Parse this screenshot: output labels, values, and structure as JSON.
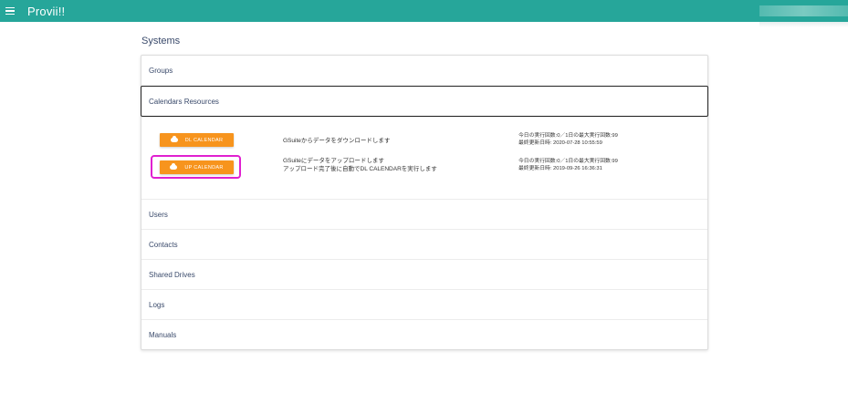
{
  "app": {
    "title": "Provii!!"
  },
  "page": {
    "title": "Systems"
  },
  "panel": {
    "groups": "Groups",
    "calendars_resources": "Calendars Resources",
    "users": "Users",
    "contacts": "Contacts",
    "shared_drives": "Shared Drives",
    "logs": "Logs",
    "manuals": "Manuals"
  },
  "calendars": {
    "dl": {
      "button": "DL CALENDAR",
      "desc": "GSuiteからデータをダウンロードします",
      "count": "今日の実行回数:0／1日の最大実行回数:99",
      "updated": "最終更新日時: 2020-07-28 10:55:59"
    },
    "up": {
      "button": "UP CALENDAR",
      "desc1": "GSuiteにデータをアップロードします",
      "desc2": "アップロード完了後に自動でDL CALENDARを実行します",
      "count": "今日の実行回数:0／1日の最大実行回数:99",
      "updated": "最終更新日時: 2019-09-26 16:36:31"
    }
  },
  "colors": {
    "topbar": "#26a69a",
    "button": "#f7941d",
    "highlight": "#e020d0"
  },
  "icons": {
    "menu": "hamburger-icon",
    "cloud": "cloud-upload-icon"
  }
}
